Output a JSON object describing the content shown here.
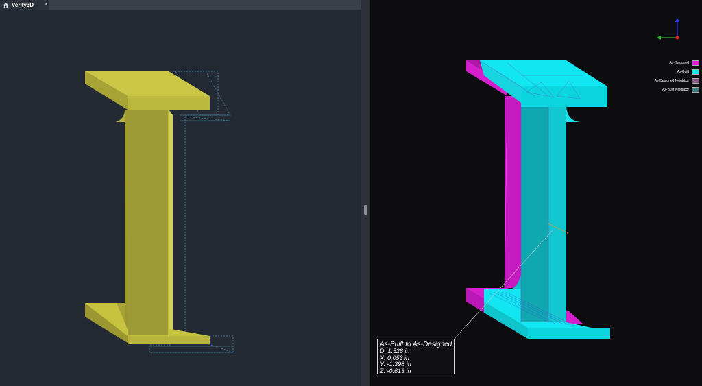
{
  "tab": {
    "title": "Verity3D",
    "close_icon": "×",
    "home_icon": "home-icon",
    "menu_icon": "chevron-down-icon"
  },
  "legend": [
    {
      "label": "As-Designed",
      "color": "#e020d8"
    },
    {
      "label": "As-Built",
      "color": "#12e6f0"
    },
    {
      "label": "As-Designed Neighbor",
      "color": "#8a5a88"
    },
    {
      "label": "As-Built Neighbor",
      "color": "#3c7c80"
    }
  ],
  "readout": {
    "title": "As-Built to As-Designed",
    "d": "D: 1.528 in",
    "x": "X: 0.053 in",
    "y": "Y: -1.398 in",
    "z": "Z: -0.613 in"
  },
  "colors": {
    "beam_yellow": "#c8c43c",
    "as_designed": "#e020d8",
    "as_built": "#12e6f0",
    "viewport_bg": "#242a33"
  }
}
